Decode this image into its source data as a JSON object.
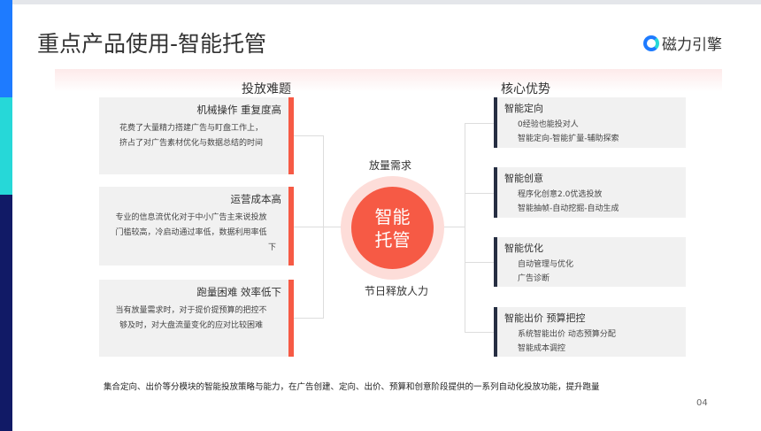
{
  "title": "重点产品使用-智能托管",
  "logo": {
    "text": "磁力引擎"
  },
  "colors": {
    "accent": "#f65a45",
    "dark": "#262e42",
    "blue": "#1e7bff",
    "cyan": "#26d8d8",
    "navy": "#111a66"
  },
  "left": {
    "heading": "投放难题",
    "items": [
      {
        "title": "机械操作 重复度高",
        "desc": [
          "花费了大量精力搭建广告与盯盘工作上，",
          "挤占了对广告素材优化与数据总结的时间"
        ]
      },
      {
        "title": "运营成本高",
        "desc": [
          "专业的信息流优化对于中小广告主来说投放",
          "门槛较高，冷启动通过率低，数据利用率低",
          "下"
        ]
      },
      {
        "title": "跑量困难 效率低下",
        "desc": [
          "当有放量需求时，对于提价提预算的把控不",
          "够及时，对大盘流量变化的应对比较困难"
        ]
      }
    ]
  },
  "center": {
    "top_label": "放量需求",
    "circle_line1": "智能",
    "circle_line2": "托管",
    "bottom_label": "节日释放人力"
  },
  "right": {
    "heading": "核心优势",
    "items": [
      {
        "title": "智能定向",
        "desc": [
          "0经验也能投对人",
          "智能定向-智能扩量-辅助探索"
        ]
      },
      {
        "title": "智能创意",
        "desc": [
          "程序化创意2.0优选投放",
          "智能抽帧-自动挖掘-自动生成"
        ]
      },
      {
        "title": "智能优化",
        "desc": [
          "自动管理与优化",
          "广告诊断"
        ]
      },
      {
        "title": "智能出价 预算把控",
        "desc": [
          "系统智能出价 动态预算分配",
          "智能成本调控"
        ]
      }
    ]
  },
  "footer": "集合定向、出价等分模块的智能投放策略与能力，在广告创建、定向、出价、预算和创意阶段提供的一系列自动化投放功能，提升跑量",
  "page_number": "04"
}
